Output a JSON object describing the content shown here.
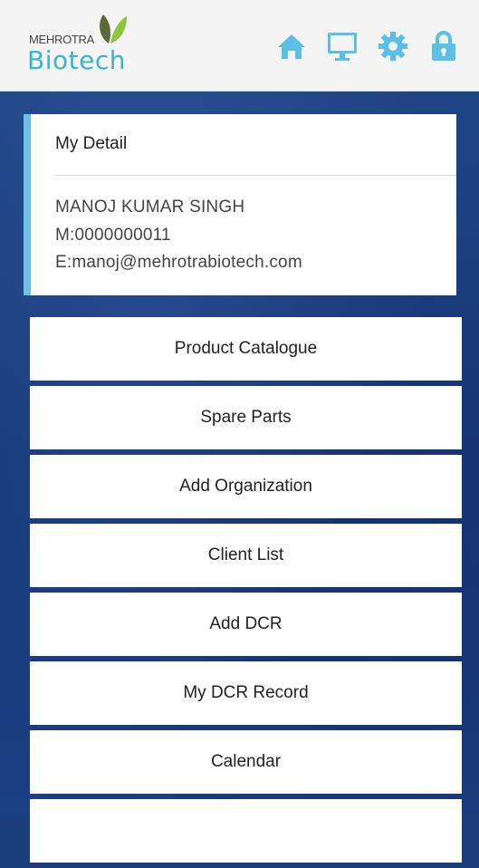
{
  "header": {
    "logo_top": "MEHROTRA",
    "logo_main": "Biotech",
    "icons": [
      "home-icon",
      "monitor-icon",
      "gear-icon",
      "lock-icon"
    ],
    "accent_color": "#3bb5c8"
  },
  "detail": {
    "title": "My Detail",
    "name": "MANOJ KUMAR SINGH",
    "mobile": "M:0000000011",
    "email": "E:manoj@mehrotrabiotech.com"
  },
  "menu": {
    "items": [
      {
        "label": "Product Catalogue"
      },
      {
        "label": "Spare Parts"
      },
      {
        "label": "Add Organization"
      },
      {
        "label": "Client List"
      },
      {
        "label": "Add DCR"
      },
      {
        "label": "My DCR Record"
      },
      {
        "label": "Calendar"
      }
    ]
  }
}
